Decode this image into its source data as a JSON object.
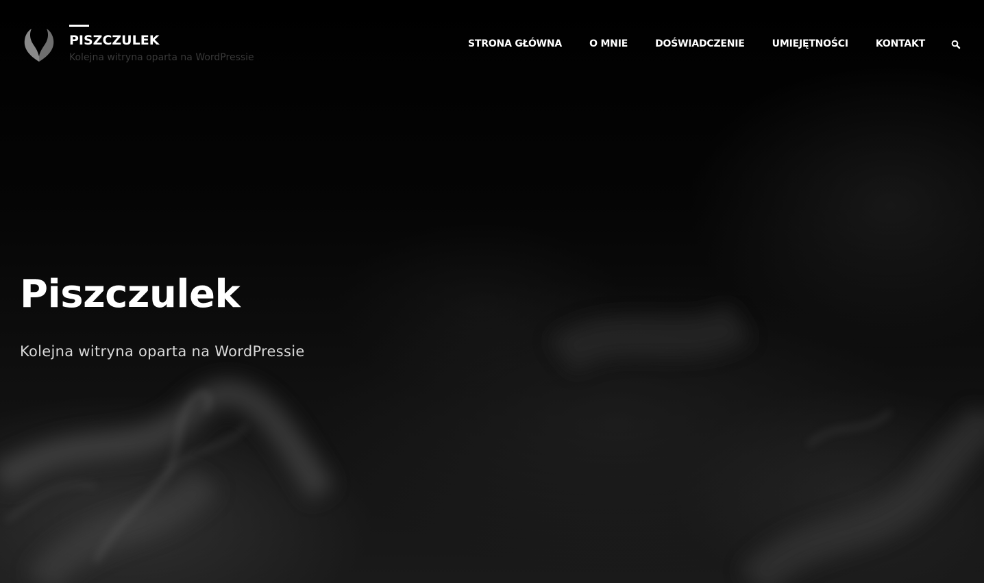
{
  "header": {
    "site_title": "PISZCZULEK",
    "tagline": "Kolejna witryna oparta na WordPressie",
    "logo_icon": "heart-leaf-logo-icon"
  },
  "nav": {
    "items": [
      {
        "label": "STRONA GŁÓWNA"
      },
      {
        "label": "O MNIE"
      },
      {
        "label": "DOŚWIADCZENIE"
      },
      {
        "label": "UMIEJĘTNOŚCI"
      },
      {
        "label": "KONTAKT"
      }
    ],
    "search_icon": "search-icon"
  },
  "hero": {
    "title": "Piszczulek",
    "subtitle": "Kolejna witryna oparta na WordPressie"
  },
  "colors": {
    "background": "#000000",
    "text": "#ffffff",
    "tagline": "#3a3a3a",
    "subtitle": "#d8d8d8"
  }
}
